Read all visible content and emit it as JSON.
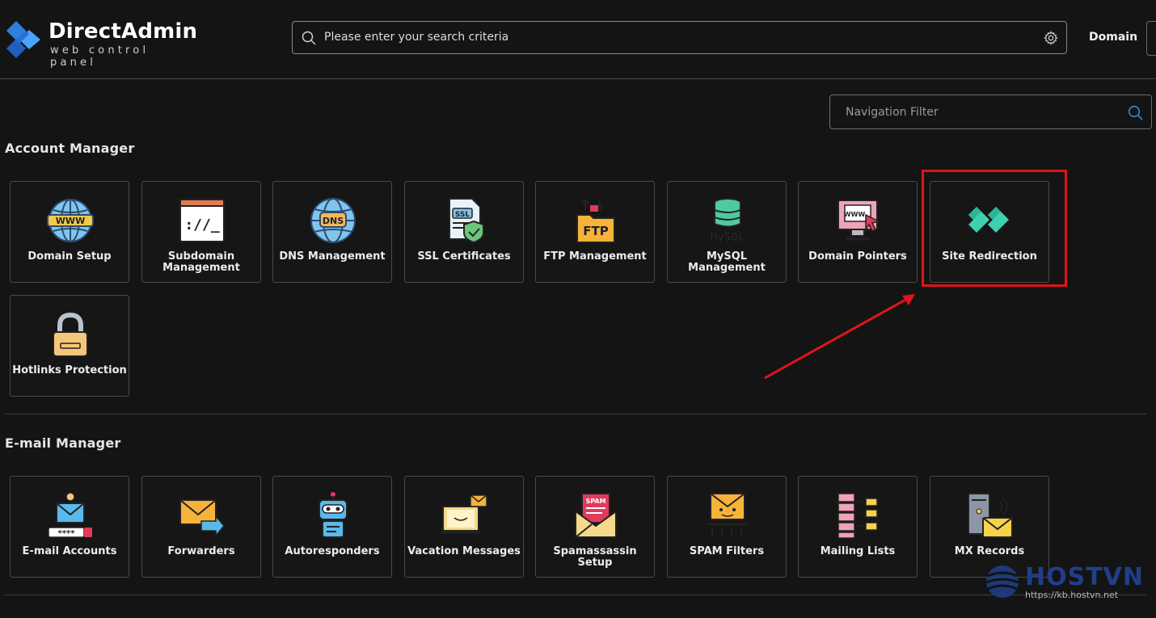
{
  "brand": {
    "name": "DirectAdmin",
    "tagline": "web control panel"
  },
  "search": {
    "placeholder": "Please enter your search criteria"
  },
  "header": {
    "domain_label": "Domain"
  },
  "nav_filter": {
    "placeholder": "Navigation Filter"
  },
  "sections": {
    "account": {
      "title": "Account Manager",
      "items": [
        {
          "label": "Domain Setup",
          "icon": "globe-www-icon"
        },
        {
          "label": "Subdomain Management",
          "icon": "terminal-window-icon"
        },
        {
          "label": "DNS Management",
          "icon": "dns-globe-icon"
        },
        {
          "label": "SSL Certificates",
          "icon": "ssl-document-icon"
        },
        {
          "label": "FTP Management",
          "icon": "ftp-folder-icon"
        },
        {
          "label": "MySQL Management",
          "icon": "mysql-database-icon"
        },
        {
          "label": "Domain Pointers",
          "icon": "monitor-www-pointer-icon"
        },
        {
          "label": "Site Redirection",
          "icon": "double-chevron-redirect-icon"
        },
        {
          "label": "Hotlinks Protection",
          "icon": "padlock-icon"
        }
      ]
    },
    "email": {
      "title": "E-mail Manager",
      "items": [
        {
          "label": "E-mail Accounts",
          "icon": "email-account-icon"
        },
        {
          "label": "Forwarders",
          "icon": "envelope-forward-icon"
        },
        {
          "label": "Autoresponders",
          "icon": "robot-icon"
        },
        {
          "label": "Vacation Messages",
          "icon": "laptop-mail-icon"
        },
        {
          "label": "Spamassassin Setup",
          "icon": "spam-envelope-icon"
        },
        {
          "label": "SPAM Filters",
          "icon": "spam-filter-icon"
        },
        {
          "label": "Mailing Lists",
          "icon": "mailing-list-icon"
        },
        {
          "label": "MX Records",
          "icon": "mx-server-mail-icon"
        }
      ]
    }
  },
  "watermark": {
    "brand": "HOSTVN",
    "url": "https://kb.hostvn.net"
  },
  "colors": {
    "highlight": "#e0141a",
    "accent_teal": "#3ed1b0",
    "background": "#141414"
  }
}
